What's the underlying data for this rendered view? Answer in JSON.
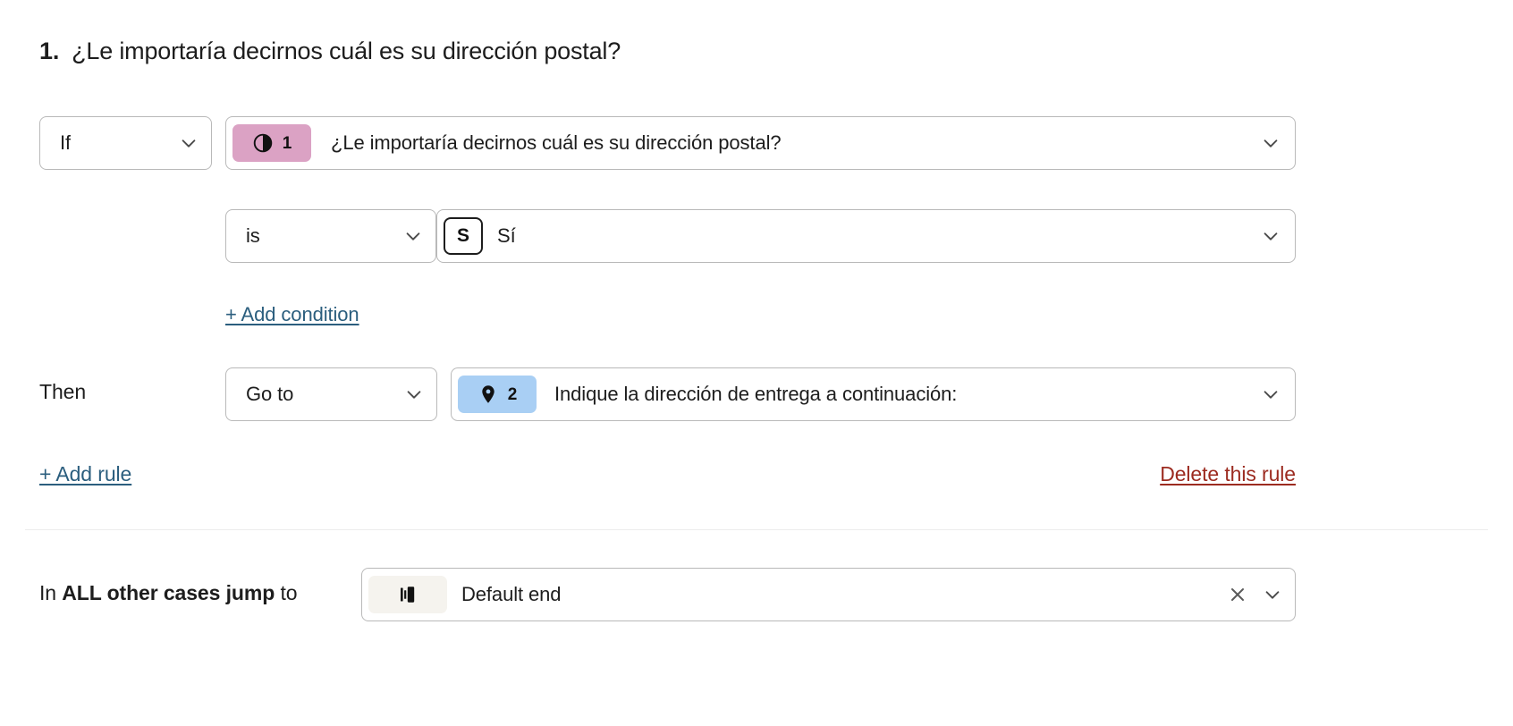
{
  "question": {
    "number": "1.",
    "title": "¿Le importaría decirnos cuál es su dirección postal?"
  },
  "rule": {
    "if_operator": "If",
    "if_target": {
      "badge_number": "1",
      "badge_icon": "yes-no-circle-icon",
      "badge_color": "#dba2c4",
      "label": "¿Le importaría decirnos cuál es su dirección postal?"
    },
    "condition": {
      "operator": "is",
      "value_key": "S",
      "value_label": "Sí"
    },
    "add_condition_label": "+ Add condition",
    "then_label": "Then",
    "then_operator": "Go to",
    "then_target": {
      "badge_number": "2",
      "badge_icon": "map-pin-icon",
      "badge_color": "#a9cff4",
      "label": "Indique la dirección de entrega a continuación:"
    },
    "add_rule_label": "+ Add rule",
    "add_rule_color": "#2b5e7e",
    "delete_rule_label": "Delete this rule",
    "delete_rule_color": "#9c2b20"
  },
  "fallback": {
    "prefix": "In ",
    "strong": "ALL other cases jump",
    "suffix": " to",
    "badge_icon": "ending-screen-icon",
    "badge_color": "#f5f3ee",
    "label": "Default end",
    "clear_icon": "close-icon",
    "chevron_icon": "chevron-down-icon"
  }
}
